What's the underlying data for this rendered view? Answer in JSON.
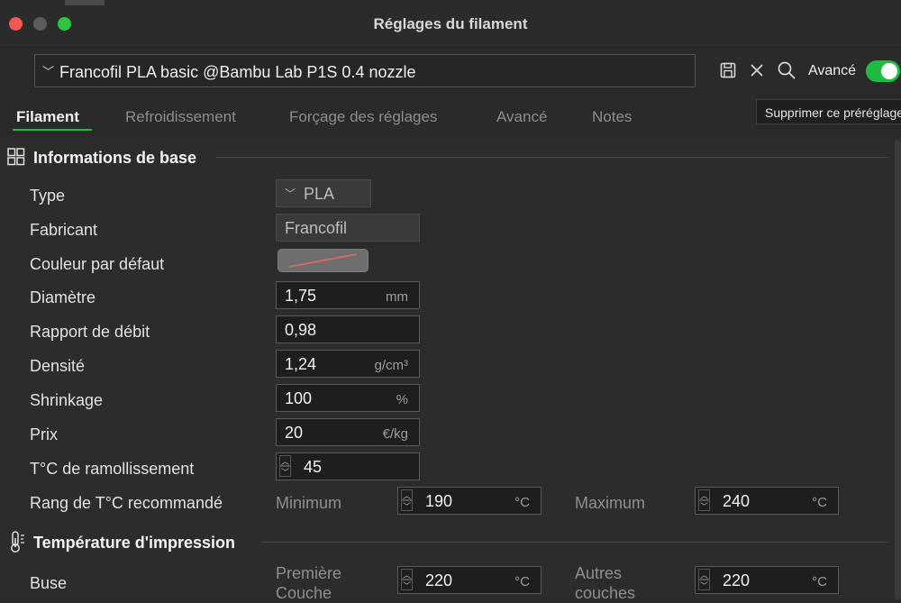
{
  "window": {
    "title": "Réglages du filament"
  },
  "preset": {
    "selected": "Francofil PLA basic @Bambu Lab P1S 0.4 nozzle"
  },
  "toolbar": {
    "advanced_label": "Avancé",
    "advanced_on": true
  },
  "tooltip": {
    "text": "Supprimer ce préréglage"
  },
  "tabs": [
    {
      "label": "Filament",
      "active": true
    },
    {
      "label": "Refroidissement"
    },
    {
      "label": "Forçage des réglages"
    },
    {
      "label": "Avancé"
    },
    {
      "label": "Notes"
    }
  ],
  "basic_info": {
    "title": "Informations de base",
    "type": {
      "label": "Type",
      "value": "PLA"
    },
    "vendor": {
      "label": "Fabricant",
      "value": "Francofil"
    },
    "default_color": {
      "label": "Couleur par défaut"
    },
    "diameter": {
      "label": "Diamètre",
      "value": "1,75",
      "unit": "mm"
    },
    "flow_ratio": {
      "label": "Rapport de débit",
      "value": "0,98"
    },
    "density": {
      "label": "Densité",
      "value": "1,24",
      "unit": "g/cm³"
    },
    "shrinkage": {
      "label": "Shrinkage",
      "value": "100",
      "unit": "%"
    },
    "price": {
      "label": "Prix",
      "value": "20",
      "unit": "€/kg"
    },
    "softening_temp": {
      "label": "T°C de ramollissement",
      "value": "45"
    },
    "nozzle_temp_range": {
      "label": "Rang de T°C recommandé",
      "min_label": "Minimum",
      "min_value": "190",
      "min_unit": "°C",
      "max_label": "Maximum",
      "max_value": "240",
      "max_unit": "°C"
    }
  },
  "print_temp": {
    "title": "Température d'impression",
    "nozzle": {
      "label": "Buse",
      "first_layer_label_1": "Première",
      "first_layer_label_2": "Couche",
      "first_layer_value": "220",
      "first_layer_unit": "°C",
      "other_layers_label_1": "Autres",
      "other_layers_label_2": "couches",
      "other_layers_value": "220",
      "other_layers_unit": "°C"
    }
  }
}
